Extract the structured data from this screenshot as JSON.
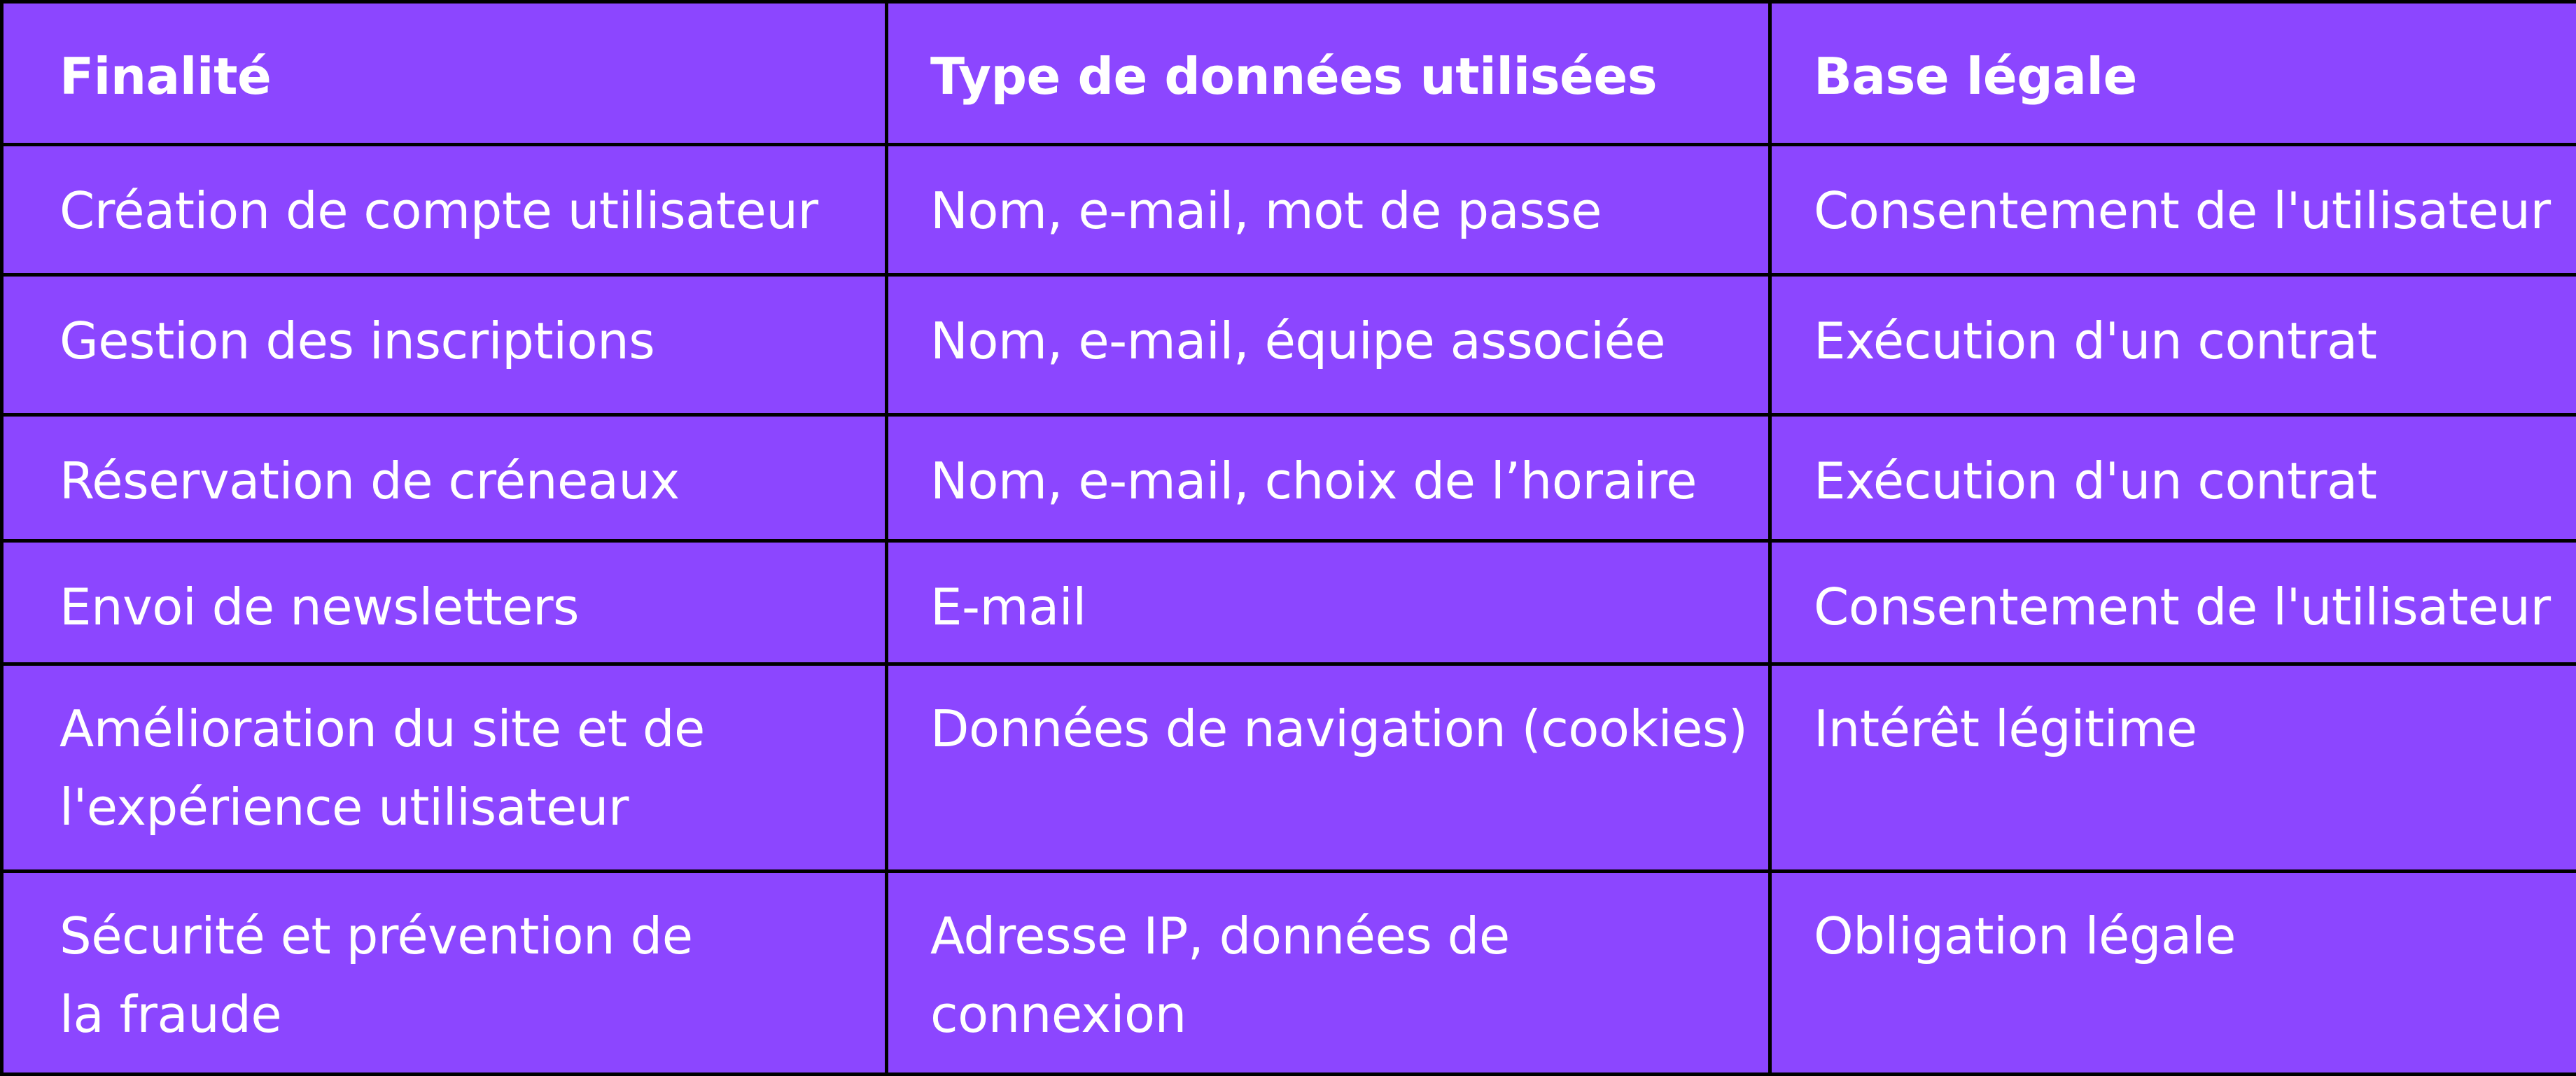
{
  "table": {
    "headers": [
      "Finalité",
      "Type de données utilisées",
      "Base légale"
    ],
    "rows": [
      [
        "Création de compte utilisateur",
        "Nom, e-mail, mot de passe",
        "Consentement de l'utilisateur"
      ],
      [
        "Gestion des inscriptions",
        "Nom, e-mail, équipe associée",
        "Exécution d'un contrat"
      ],
      [
        "Réservation de créneaux",
        "Nom, e-mail, choix de l’horaire",
        "Exécution d'un contrat"
      ],
      [
        "Envoi de newsletters",
        "E-mail",
        "Consentement de l'utilisateur"
      ],
      [
        [
          "Amélioration du site et de",
          "l'expérience utilisateur"
        ],
        "Données de navigation (cookies)",
        "Intérêt légitime"
      ],
      [
        [
          "Sécurité et prévention de",
          "la fraude"
        ],
        [
          "Adresse IP, données de",
          "connexion"
        ],
        "Obligation légale"
      ]
    ]
  },
  "colors": {
    "cell_background": "#8c46ff",
    "border": "#000000",
    "text": "#ffffff"
  }
}
